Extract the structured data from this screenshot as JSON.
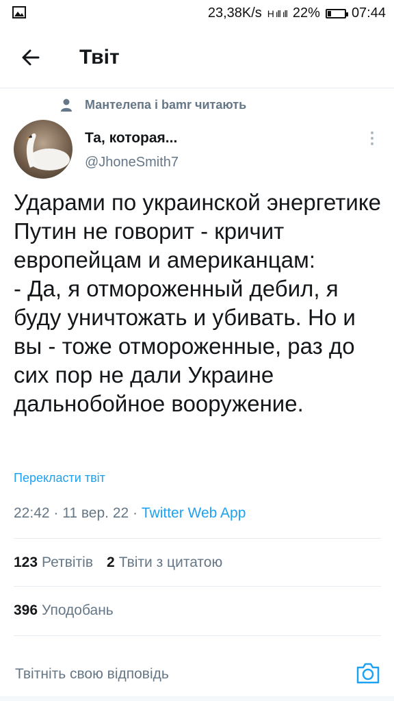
{
  "status_bar": {
    "image_icon": "image-icon",
    "speed": "23,38K/s",
    "signal": "H ıll ıll",
    "battery_percent": "22%",
    "battery_level": 0.22,
    "time": "07:44"
  },
  "header": {
    "back_icon": "arrow-left-icon",
    "title": "Твіт"
  },
  "context": {
    "icon": "person-icon",
    "text": "Мантелепа і bamr читають"
  },
  "author": {
    "name": "Та, которая...",
    "handle": "@JhoneSmith7"
  },
  "tweet": {
    "text": "Ударами по украинской энергетике Путин не говорит - кричит европейцам и американцам:\n- Да, я отмороженный дебил, я буду уничтожать и убивать. Но и вы - тоже отмороженные, раз до сих пор не дали Украине дальнобойное вооружение.",
    "translate_label": "Перекласти твіт",
    "time": "22:42",
    "sep1": " · ",
    "date": "11 вер. 22",
    "sep2": " · ",
    "app": "Twitter Web App"
  },
  "stats": {
    "retweets_count": "123",
    "retweets_label": "Ретвітів",
    "quotes_count": "2",
    "quotes_label": "Твіти з цитатою",
    "likes_count": "396",
    "likes_label": "Уподобань"
  },
  "reply": {
    "placeholder": "Твітніть свою відповідь",
    "camera_icon": "camera-icon"
  }
}
